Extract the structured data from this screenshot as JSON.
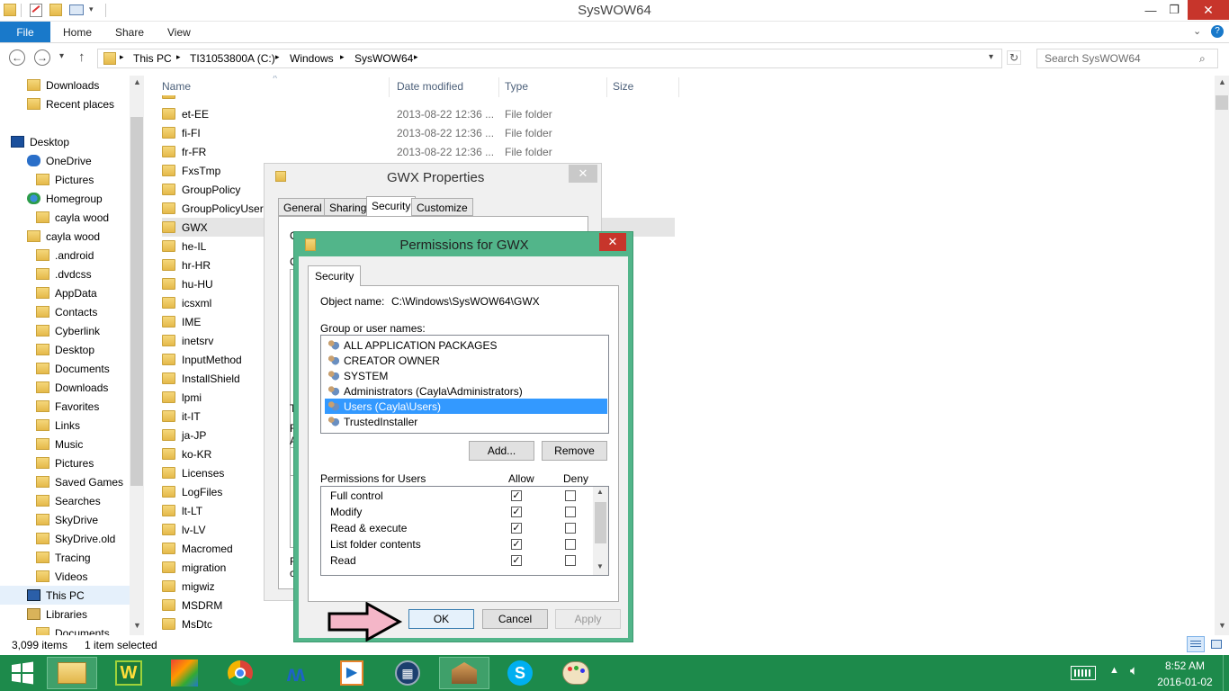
{
  "window": {
    "title": "SysWOW64"
  },
  "ribbon": {
    "file": "File",
    "home": "Home",
    "share": "Share",
    "view": "View"
  },
  "address": {
    "crumbs": [
      "This PC",
      "TI31053800A (C:)",
      "Windows",
      "SysWOW64"
    ],
    "search_placeholder": "Search SysWOW64"
  },
  "nav": {
    "items": [
      {
        "label": "Downloads",
        "indent": 1
      },
      {
        "label": "Recent places",
        "indent": 1
      },
      {
        "label": "",
        "indent": 0
      },
      {
        "label": "Desktop",
        "indent": 0
      },
      {
        "label": "OneDrive",
        "indent": 1
      },
      {
        "label": "Pictures",
        "indent": 2
      },
      {
        "label": "Homegroup",
        "indent": 1
      },
      {
        "label": "cayla wood",
        "indent": 2
      },
      {
        "label": "cayla wood",
        "indent": 1
      },
      {
        "label": ".android",
        "indent": 2
      },
      {
        "label": ".dvdcss",
        "indent": 2
      },
      {
        "label": "AppData",
        "indent": 2
      },
      {
        "label": "Contacts",
        "indent": 2
      },
      {
        "label": "Cyberlink",
        "indent": 2
      },
      {
        "label": "Desktop",
        "indent": 2
      },
      {
        "label": "Documents",
        "indent": 2
      },
      {
        "label": "Downloads",
        "indent": 2
      },
      {
        "label": "Favorites",
        "indent": 2
      },
      {
        "label": "Links",
        "indent": 2
      },
      {
        "label": "Music",
        "indent": 2
      },
      {
        "label": "Pictures",
        "indent": 2
      },
      {
        "label": "Saved Games",
        "indent": 2
      },
      {
        "label": "Searches",
        "indent": 2
      },
      {
        "label": "SkyDrive",
        "indent": 2
      },
      {
        "label": "SkyDrive.old",
        "indent": 2
      },
      {
        "label": "Tracing",
        "indent": 2
      },
      {
        "label": "Videos",
        "indent": 2
      },
      {
        "label": "This PC",
        "indent": 1
      },
      {
        "label": "Libraries",
        "indent": 1
      },
      {
        "label": "Documents",
        "indent": 2
      }
    ]
  },
  "list": {
    "headers": {
      "name": "Name",
      "date": "Date modified",
      "type": "Type",
      "size": "Size"
    },
    "rows": [
      {
        "name": "et-EE",
        "date": "2013-08-22 12:36 ...",
        "type": "File folder"
      },
      {
        "name": "fi-FI",
        "date": "2013-08-22 12:36 ...",
        "type": "File folder"
      },
      {
        "name": "fr-FR",
        "date": "2013-08-22 12:36 ...",
        "type": "File folder"
      },
      {
        "name": "FxsTmp",
        "date": "",
        "type": ""
      },
      {
        "name": "GroupPolicy",
        "date": "",
        "type": ""
      },
      {
        "name": "GroupPolicyUsers",
        "date": "",
        "type": ""
      },
      {
        "name": "GWX",
        "date": "",
        "type": ""
      },
      {
        "name": "he-IL",
        "date": "",
        "type": ""
      },
      {
        "name": "hr-HR",
        "date": "",
        "type": ""
      },
      {
        "name": "hu-HU",
        "date": "",
        "type": ""
      },
      {
        "name": "icsxml",
        "date": "",
        "type": ""
      },
      {
        "name": "IME",
        "date": "",
        "type": ""
      },
      {
        "name": "inetsrv",
        "date": "",
        "type": ""
      },
      {
        "name": "InputMethod",
        "date": "",
        "type": ""
      },
      {
        "name": "InstallShield",
        "date": "",
        "type": ""
      },
      {
        "name": "lpmi",
        "date": "",
        "type": ""
      },
      {
        "name": "it-IT",
        "date": "",
        "type": ""
      },
      {
        "name": "ja-JP",
        "date": "",
        "type": ""
      },
      {
        "name": "ko-KR",
        "date": "",
        "type": ""
      },
      {
        "name": "Licenses",
        "date": "",
        "type": ""
      },
      {
        "name": "LogFiles",
        "date": "",
        "type": ""
      },
      {
        "name": "lt-LT",
        "date": "",
        "type": ""
      },
      {
        "name": "lv-LV",
        "date": "",
        "type": ""
      },
      {
        "name": "Macromed",
        "date": "",
        "type": ""
      },
      {
        "name": "migration",
        "date": "",
        "type": ""
      },
      {
        "name": "migwiz",
        "date": "",
        "type": ""
      },
      {
        "name": "MSDRM",
        "date": "",
        "type": ""
      },
      {
        "name": "MsDtc",
        "date": "",
        "type": ""
      }
    ]
  },
  "status": {
    "count": "3,099 items",
    "selected": "1 item selected"
  },
  "props": {
    "title": "GWX Properties",
    "tabs": [
      "General",
      "Sharing",
      "Security",
      "Customize"
    ]
  },
  "perm": {
    "title": "Permissions for GWX",
    "tab": "Security",
    "object_label": "Object name:",
    "object_value": "C:\\Windows\\SysWOW64\\GWX",
    "group_label": "Group or user names:",
    "users": [
      "ALL APPLICATION PACKAGES",
      "CREATOR OWNER",
      "SYSTEM",
      "Administrators (Cayla\\Administrators)",
      "Users (Cayla\\Users)",
      "TrustedInstaller"
    ],
    "add": "Add...",
    "remove": "Remove",
    "perm_label": "Permissions for Users",
    "allow": "Allow",
    "deny": "Deny",
    "permissions": [
      {
        "name": "Full control",
        "allow": true,
        "deny": false
      },
      {
        "name": "Modify",
        "allow": true,
        "deny": false
      },
      {
        "name": "Read & execute",
        "allow": true,
        "deny": false
      },
      {
        "name": "List folder contents",
        "allow": true,
        "deny": false
      },
      {
        "name": "Read",
        "allow": true,
        "deny": false
      }
    ],
    "ok": "OK",
    "cancel": "Cancel",
    "apply": "Apply"
  },
  "tray": {
    "time": "8:52 AM",
    "date": "2016-01-02"
  },
  "colors": {
    "accent": "#1979ca",
    "taskbar": "#1d8a4b",
    "dialog_frame": "#52b58a",
    "selection": "#3399ff",
    "arrow": "#f4b6c8"
  }
}
